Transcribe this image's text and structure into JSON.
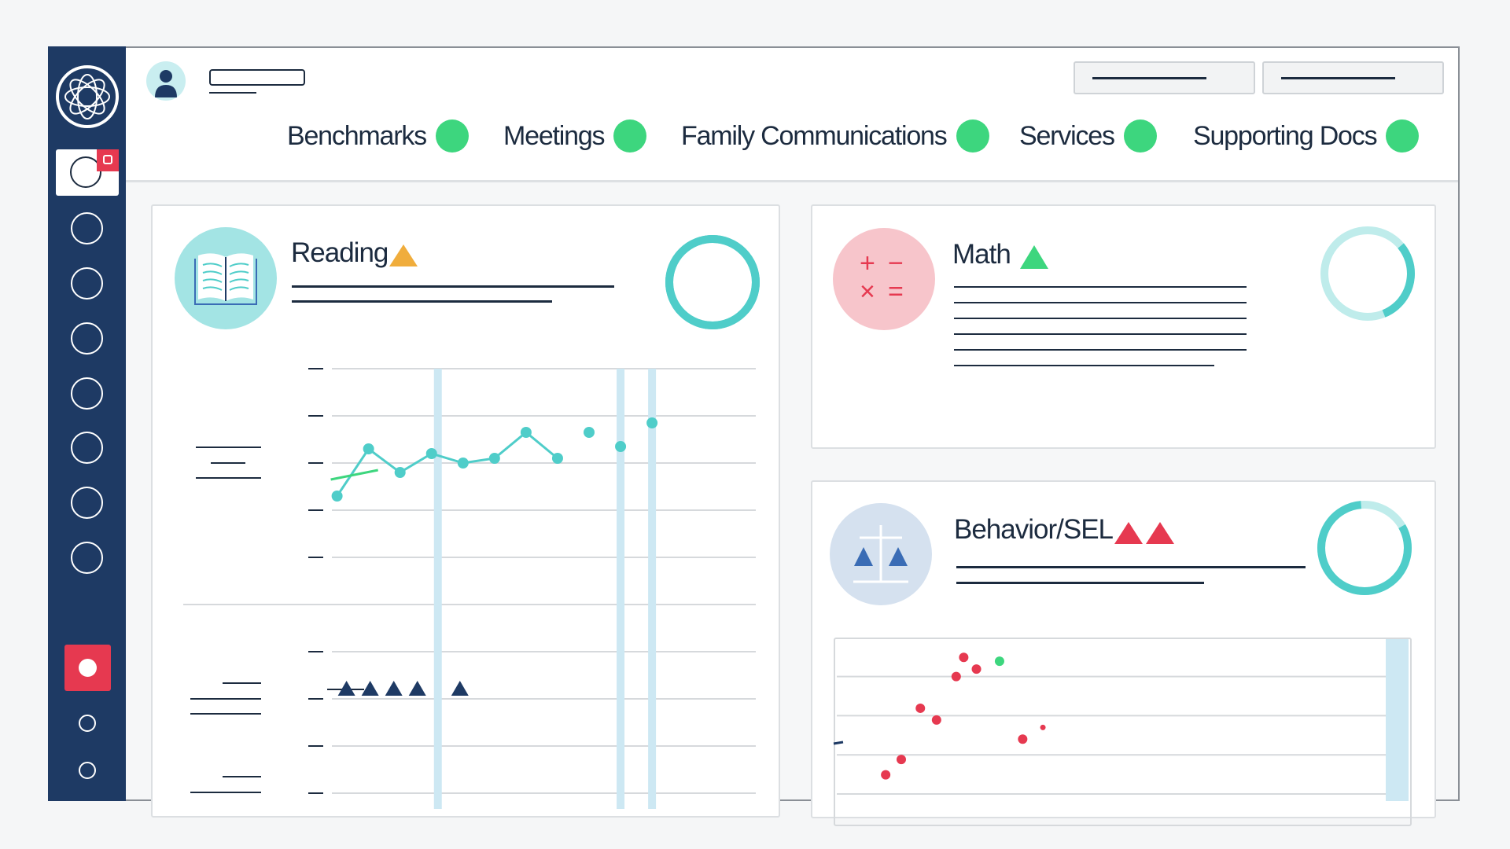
{
  "colors": {
    "navy": "#1e3a64",
    "teal": "#4fcdc9",
    "light_teal": "#bfeceb",
    "status_green": "#3dd67e",
    "warning_orange": "#f0ad3c",
    "alert_red": "#e63950",
    "scale_blue": "#3a6cb5",
    "grid": "#d6d9dc",
    "highlight": "#cde8f3"
  },
  "sidebar": {
    "logo": "atom-logo-icon",
    "items": [
      "circle-icon",
      "circle-icon",
      "circle-icon",
      "circle-icon",
      "circle-icon",
      "circle-icon",
      "circle-icon"
    ],
    "active_item_badge": "notification-badge",
    "record_button": "record-icon"
  },
  "header": {
    "avatar": "user-icon"
  },
  "tabs": [
    {
      "label": "Benchmarks",
      "status": "green"
    },
    {
      "label": "Meetings",
      "status": "green"
    },
    {
      "label": "Family Communications",
      "status": "green"
    },
    {
      "label": "Services",
      "status": "green"
    },
    {
      "label": "Supporting Docs",
      "status": "green"
    }
  ],
  "cards": {
    "reading": {
      "title": "Reading",
      "icon": "open-book-icon",
      "alert": "warning-triangle-orange"
    },
    "math": {
      "title": "Math",
      "icon": "math-operators-icon",
      "symbols": [
        "+",
        "−",
        "×",
        "="
      ],
      "alert": "triangle-green"
    },
    "behavior": {
      "title": "Behavior/SEL",
      "icon": "balance-scale-icon",
      "alert": "two-red-triangles"
    }
  },
  "chart_data": [
    {
      "type": "line",
      "card": "Reading",
      "ylim": [
        0,
        4
      ],
      "grid": true,
      "series": [
        {
          "x": [
            0,
            1,
            2,
            3,
            4,
            5,
            6,
            7
          ],
          "y": [
            1.3,
            2.3,
            1.8,
            2.2,
            2.0,
            2.1,
            2.65,
            2.1
          ]
        }
      ],
      "points": [
        {
          "x": 8,
          "y": 2.65
        },
        {
          "x": 9,
          "y": 2.35
        },
        {
          "x": 10,
          "y": 2.85
        }
      ],
      "trend": {
        "x": [
          -0.2,
          1.3
        ],
        "y": [
          1.65,
          1.85
        ]
      },
      "highlight_x": [
        3.2,
        9.0,
        10.0
      ]
    },
    {
      "type": "scatter",
      "card": "Reading",
      "ylim": [
        0,
        3
      ],
      "grid": true,
      "marker": "triangle",
      "points": [
        {
          "x": 0.3,
          "y": 2.2
        },
        {
          "x": 1.05,
          "y": 2.2
        },
        {
          "x": 1.8,
          "y": 2.2
        },
        {
          "x": 2.55,
          "y": 2.2
        },
        {
          "x": 3.9,
          "y": 2.2
        }
      ],
      "highlight_x": [
        3.2,
        9.0,
        10.0
      ]
    },
    {
      "type": "scatter",
      "card": "Behavior/SEL",
      "ylim": [
        0,
        3.6
      ],
      "xlim": [
        0,
        100
      ],
      "grid": true,
      "points": [
        {
          "x": 22.5,
          "y": 3.49,
          "c": "red"
        },
        {
          "x": 24.7,
          "y": 3.19,
          "c": "red"
        },
        {
          "x": 21.2,
          "y": 3.0,
          "c": "red"
        },
        {
          "x": 28.7,
          "y": 3.39,
          "c": "green"
        },
        {
          "x": 15,
          "y": 2.19,
          "c": "red"
        },
        {
          "x": 17.8,
          "y": 1.89,
          "c": "red"
        },
        {
          "x": 32.7,
          "y": 1.4,
          "c": "red"
        },
        {
          "x": 36.2,
          "y": 1.7,
          "c": "red",
          "small": true
        },
        {
          "x": 11.7,
          "y": 0.88,
          "c": "red"
        },
        {
          "x": 9,
          "y": 0.49,
          "c": "red"
        }
      ],
      "highlight_x": [
        97
      ]
    }
  ],
  "rings": {
    "reading": 1.0,
    "math": 0.3,
    "behavior": 0.82
  }
}
